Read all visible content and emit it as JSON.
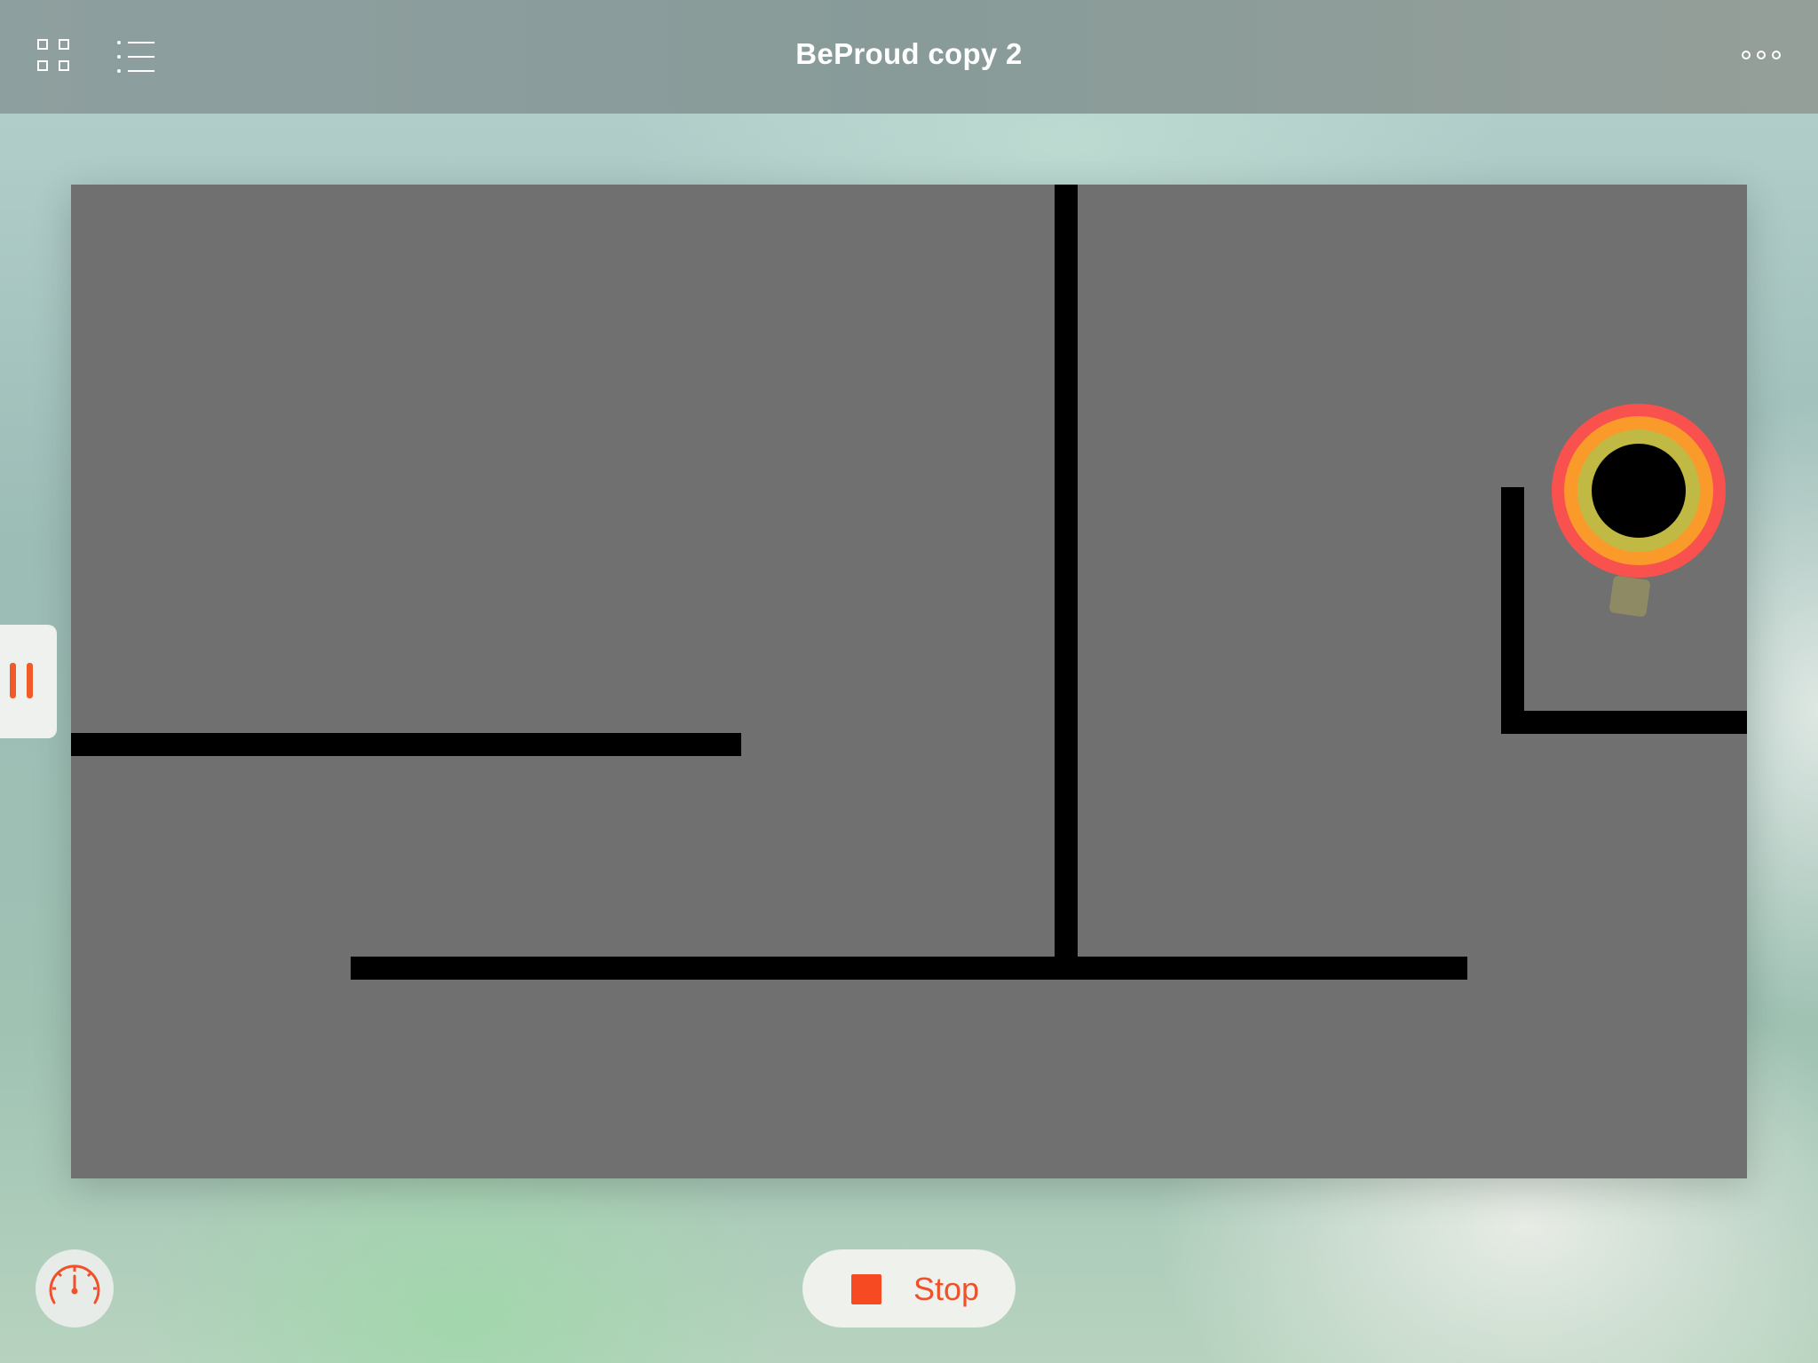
{
  "header": {
    "title": "BeProud copy 2",
    "left_icons": [
      "grid-icon",
      "list-icon"
    ],
    "right_icon": "more-icon"
  },
  "side_tab": {
    "icon": "pause-icon",
    "accent": "#f35a2a"
  },
  "stage": {
    "background": "#707070",
    "wall_color": "#000000",
    "target_rings": [
      "#f9514d",
      "#fa9a2b",
      "#c0ba44",
      "#000000"
    ],
    "sprite_color": "#8e8a64"
  },
  "footer": {
    "speed_icon": "speedometer-icon",
    "stop_label": "Stop",
    "stop_icon": "stop-square-icon",
    "accent": "#f64a22"
  }
}
